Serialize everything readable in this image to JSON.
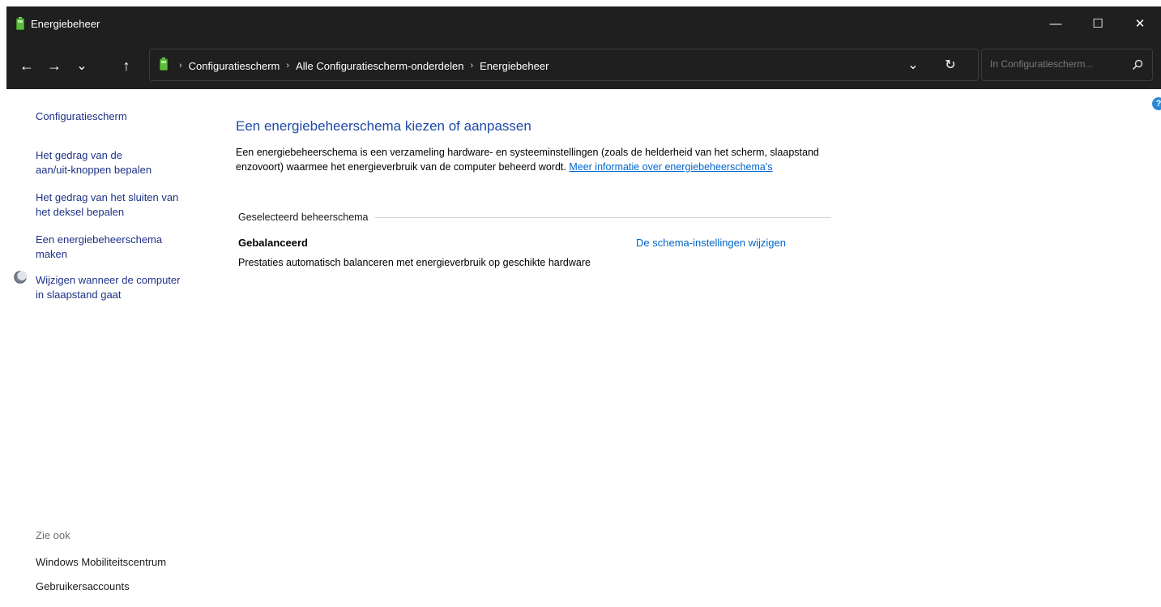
{
  "window": {
    "title": "Energiebeheer",
    "controls": {
      "minimize": "—",
      "maximize": "☐",
      "close": "✕"
    }
  },
  "nav": {
    "back": "←",
    "forward": "→",
    "recent": "⌄",
    "up": "↑",
    "breadcrumbs": [
      "Configuratiescherm",
      "Alle Configuratiescherm-onderdelen",
      "Energiebeheer"
    ],
    "separator": "›",
    "dropdown": "⌄",
    "refresh": "↻",
    "search_placeholder": "In Configuratiescherm..."
  },
  "help": "?",
  "sidebar": {
    "home": "Configuratiescherm",
    "items": [
      {
        "line1": "Het gedrag van de",
        "line2": "aan/uit-knoppen bepalen"
      },
      {
        "line1": "Het gedrag van het sluiten van",
        "line2": "het deksel bepalen"
      },
      {
        "line1": "Een energiebeheerschema",
        "line2": "maken"
      },
      {
        "line1": "Wijzigen wanneer de computer",
        "line2": "in slaapstand gaat"
      }
    ],
    "see_also_label": "Zie ook",
    "see_also": [
      "Windows Mobiliteitscentrum",
      "Gebruikersaccounts"
    ]
  },
  "main": {
    "title": "Een energiebeheerschema kiezen of aanpassen",
    "description": "Een energiebeheerschema is een verzameling hardware- en systeeminstellingen (zoals de helderheid van het scherm, slaapstand enzovoort) waarmee het energieverbruik van de computer beheerd wordt.",
    "more_link": "Meer informatie over energiebeheerschema's",
    "group_label": "Geselecteerd beheerschema",
    "plan": {
      "name": "Gebalanceerd",
      "change_link": "De schema-instellingen wijzigen",
      "description": "Prestaties automatisch balanceren met energieverbruik op geschikte hardware"
    }
  },
  "colors": {
    "titlebar": "#1f1f1f",
    "link": "#1e3287",
    "accent_link": "#0066cc",
    "heading": "#1e4aa8",
    "battery": "#5bbd3b"
  }
}
